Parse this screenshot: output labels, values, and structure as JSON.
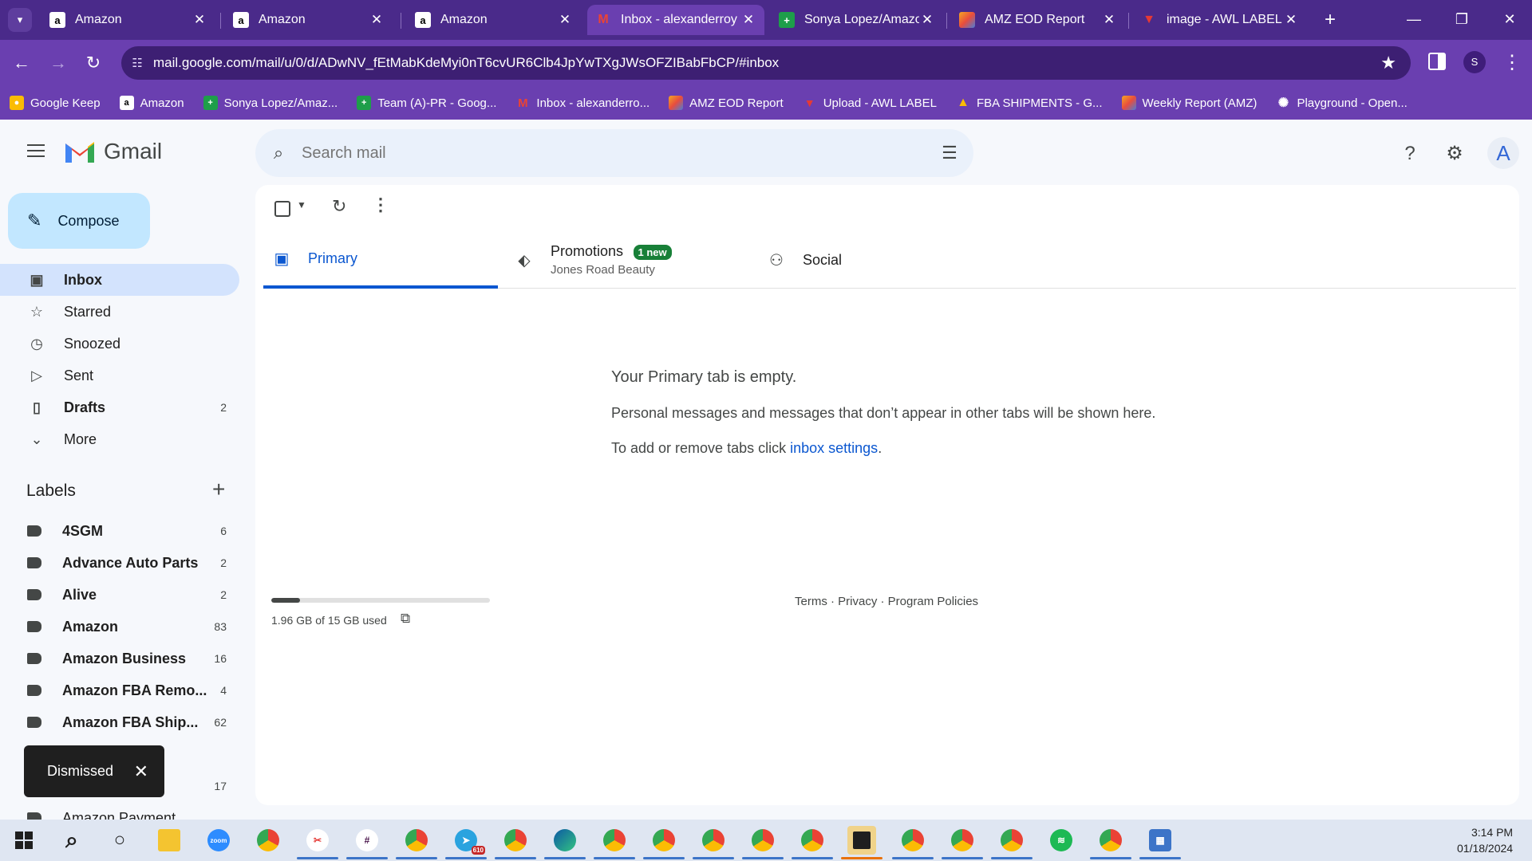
{
  "browser": {
    "tabs": [
      {
        "label": "Amazon",
        "icon": "amazon-icon",
        "active": false
      },
      {
        "label": "Amazon",
        "icon": "amazon-icon",
        "active": false
      },
      {
        "label": "Amazon",
        "icon": "amazon-icon",
        "active": false
      },
      {
        "label": "Inbox - alexanderroy",
        "icon": "gmail-icon",
        "active": true
      },
      {
        "label": "Sonya Lopez/Amazon",
        "icon": "sheets-icon",
        "active": false
      },
      {
        "label": "AMZ EOD Report",
        "icon": "app-icon",
        "active": false
      },
      {
        "label": "image - AWL LABEL",
        "icon": "awl-icon",
        "active": false
      }
    ],
    "url": "mail.google.com/mail/u/0/d/ADwNV_fEtMabKdeMyi0nT6cvUR6Clb4JpYwTXgJWsOFZIBabFbCP/#inbox",
    "profile_initial": "S",
    "bookmarks": [
      {
        "label": "Google Keep",
        "icon": "keep-icon"
      },
      {
        "label": "Amazon",
        "icon": "amazon-icon"
      },
      {
        "label": "Sonya Lopez/Amaz...",
        "icon": "sheets-icon"
      },
      {
        "label": "Team (A)-PR - Goog...",
        "icon": "sheets-icon"
      },
      {
        "label": "Inbox - alexanderro...",
        "icon": "gmail-icon"
      },
      {
        "label": "AMZ EOD Report",
        "icon": "app-icon"
      },
      {
        "label": "Upload - AWL LABEL",
        "icon": "awl-icon"
      },
      {
        "label": "FBA SHIPMENTS - G...",
        "icon": "drive-icon"
      },
      {
        "label": "Weekly Report (AMZ)",
        "icon": "app-icon"
      },
      {
        "label": "Playground - Open...",
        "icon": "openai-icon"
      }
    ]
  },
  "gmail": {
    "product_name": "Gmail",
    "search_placeholder": "Search mail",
    "avatar_initial": "A",
    "compose_label": "Compose",
    "nav": [
      {
        "label": "Inbox",
        "icon": "inbox-icon",
        "count": "",
        "active": true
      },
      {
        "label": "Starred",
        "icon": "star-icon",
        "count": "",
        "active": false
      },
      {
        "label": "Snoozed",
        "icon": "clock-icon",
        "count": "",
        "active": false
      },
      {
        "label": "Sent",
        "icon": "send-icon",
        "count": "",
        "active": false
      },
      {
        "label": "Drafts",
        "icon": "draft-icon",
        "count": "2",
        "active": false
      },
      {
        "label": "More",
        "icon": "chevron-down-icon",
        "count": "",
        "active": false
      }
    ],
    "labels_title": "Labels",
    "labels": [
      {
        "label": "4SGM",
        "count": "6"
      },
      {
        "label": "Advance Auto Parts",
        "count": "2"
      },
      {
        "label": "Alive",
        "count": "2"
      },
      {
        "label": "Amazon",
        "count": "83"
      },
      {
        "label": "Amazon Business",
        "count": "16"
      },
      {
        "label": "Amazon FBA Remo...",
        "count": "4"
      },
      {
        "label": "Amazon FBA Ship...",
        "count": "62"
      },
      {
        "label": "",
        "count": "17"
      },
      {
        "label": "Amazon Payment",
        "count": ""
      }
    ],
    "tabs": {
      "primary": "Primary",
      "promotions": "Promotions",
      "promotions_badge": "1 new",
      "promotions_sub": "Jones Road Beauty",
      "social": "Social"
    },
    "empty": {
      "title": "Your Primary tab is empty.",
      "description": "Personal messages and messages that don’t appear in other tabs will be shown here.",
      "settings_prefix": "To add or remove tabs click ",
      "settings_link": "inbox settings",
      "settings_suffix": "."
    },
    "storage": {
      "text": "1.96 GB of 15 GB used",
      "fraction": 0.13
    },
    "footer": "Terms · Privacy · Program Policies",
    "snackbar": "Dismissed"
  },
  "taskbar": {
    "time": "3:14 PM",
    "date": "01/18/2024",
    "telegram_badge": "610"
  }
}
